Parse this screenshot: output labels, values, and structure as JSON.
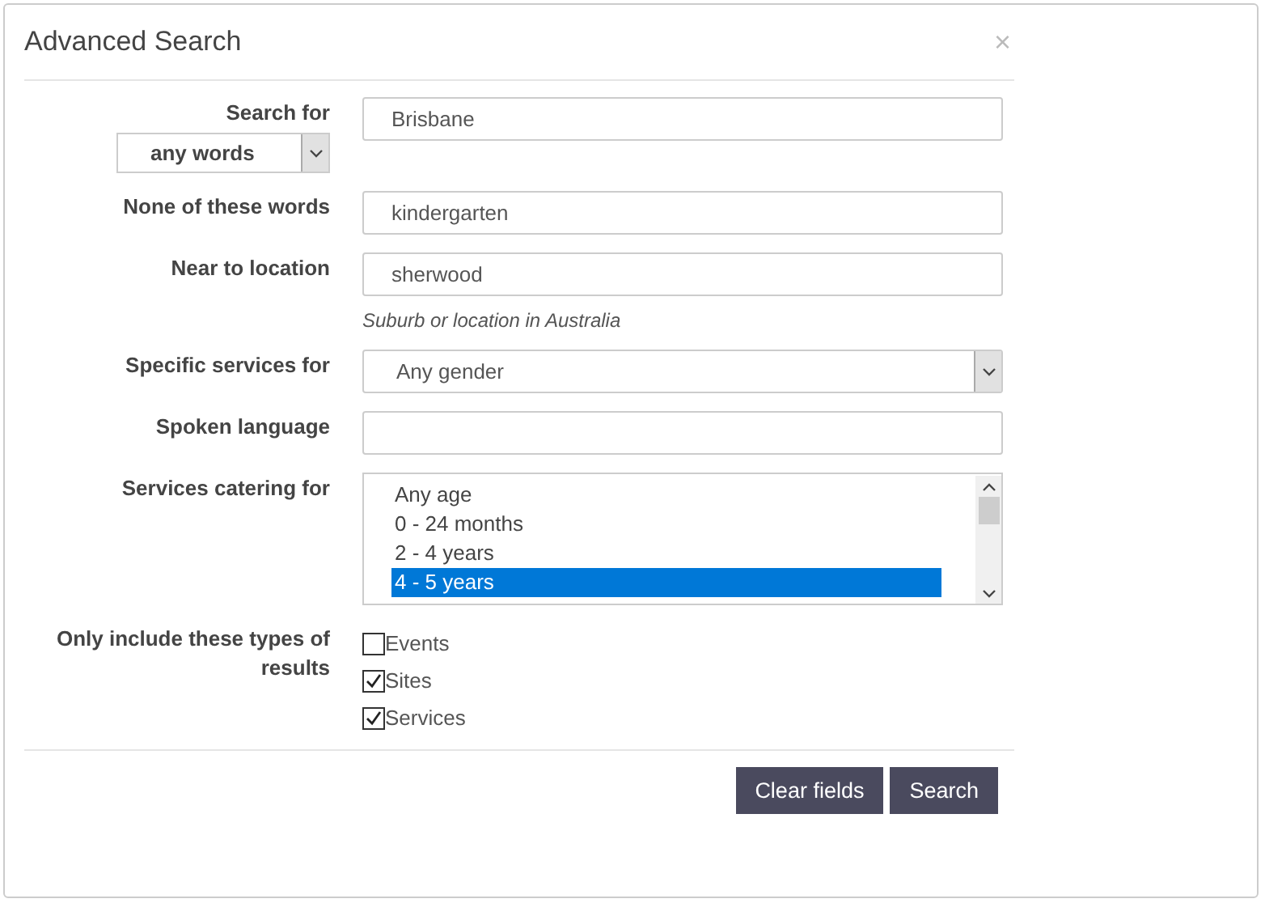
{
  "dialog": {
    "title": "Advanced Search",
    "close": "×"
  },
  "fields": [
    {
      "kind": "text-with-mode",
      "label": "Search for",
      "mode": "any words",
      "value": "Brisbane"
    },
    {
      "kind": "text",
      "label": "None of these words",
      "value": "kindergarten"
    },
    {
      "kind": "text",
      "label": "Near to location",
      "value": "sherwood",
      "hint": "Suburb or location in Australia"
    },
    {
      "kind": "select",
      "label": "Specific services for",
      "value": "Any gender"
    },
    {
      "kind": "text",
      "label": "Spoken language"
    },
    {
      "kind": "listbox",
      "label": "Services catering for",
      "options": [
        {
          "label": "Any age",
          "selected": false
        },
        {
          "label": "0 - 24 months",
          "selected": false
        },
        {
          "label": "2 - 4 years",
          "selected": false
        },
        {
          "label": "4 - 5 years",
          "selected": true
        }
      ]
    },
    {
      "kind": "checkboxes",
      "label": "Only include these types of results",
      "options": [
        {
          "label": "Events",
          "checked": false
        },
        {
          "label": "Sites",
          "checked": true
        },
        {
          "label": "Services",
          "checked": true
        }
      ]
    }
  ],
  "buttons": [
    {
      "label": "Clear fields"
    },
    {
      "label": "Search"
    }
  ]
}
